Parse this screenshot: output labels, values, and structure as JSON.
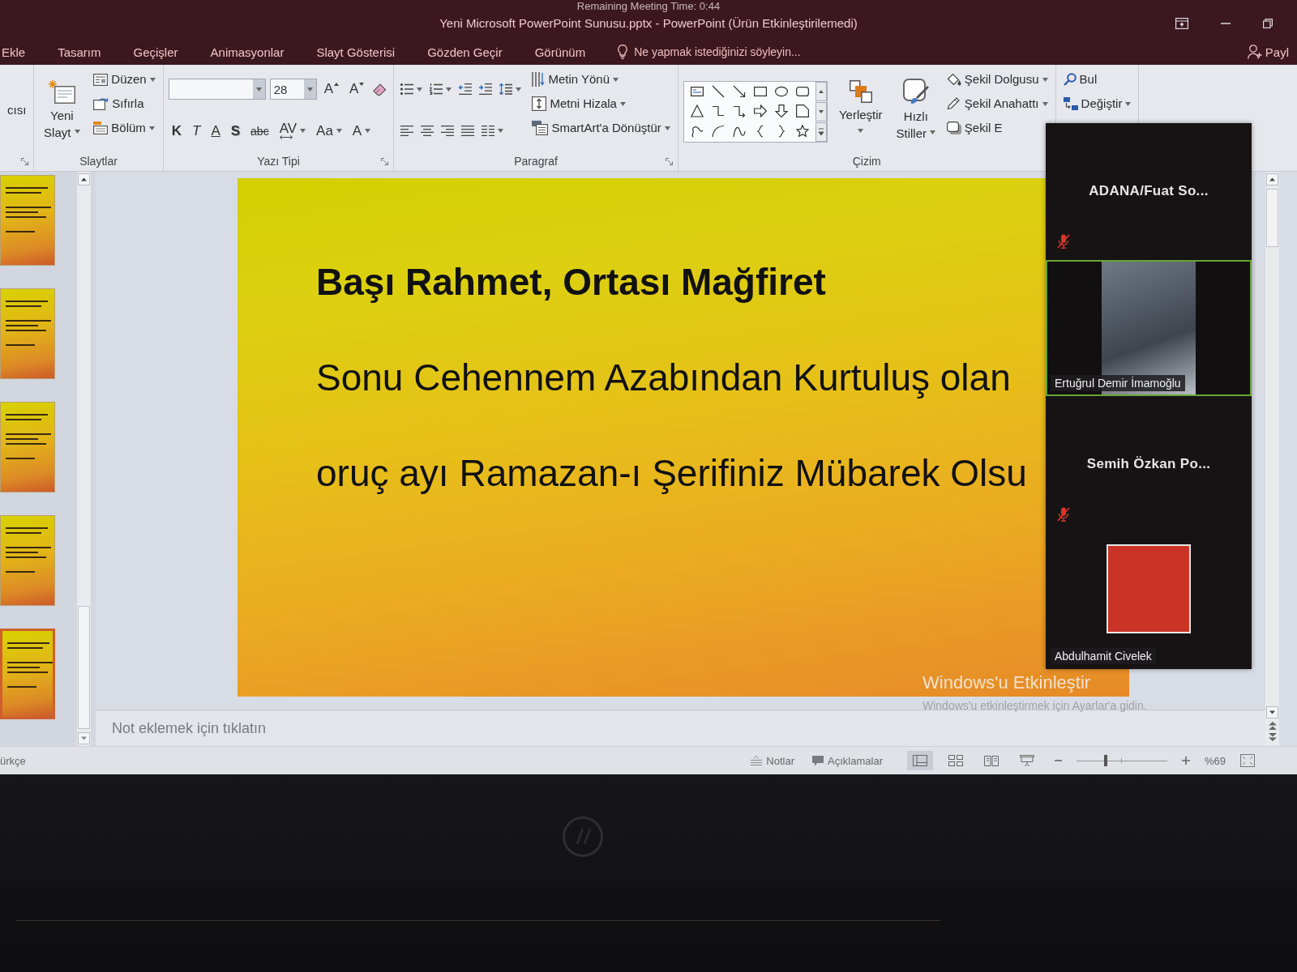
{
  "meeting_timer": "Remaining Meeting Time: 0:44",
  "window": {
    "title": "Yeni Microsoft PowerPoint Sunusu.pptx - PowerPoint (Ürün Etkinleştirilemedi)"
  },
  "tabs": [
    {
      "label": "Ekle",
      "selected": false
    },
    {
      "label": "Tasarım",
      "selected": false
    },
    {
      "label": "Geçişler",
      "selected": false
    },
    {
      "label": "Animasyonlar",
      "selected": false
    },
    {
      "label": "Slayt Gösterisi",
      "selected": false
    },
    {
      "label": "Gözden Geçir",
      "selected": false
    },
    {
      "label": "Görünüm",
      "selected": false
    }
  ],
  "tell_me": {
    "placeholder": "Ne yapmak istediğinizi söyleyin..."
  },
  "share": {
    "label": "Payl"
  },
  "ribbon": {
    "groups": [
      {
        "launcher": true,
        "blocks": [
          {
            "tiers": [
              [
                {
                  "kind": "text",
                  "label": "cısı",
                  "dropdown": false
                }
              ]
            ]
          }
        ]
      },
      {
        "label": "Slaytlar",
        "launcher": false,
        "blocks": [
          {
            "tiers": [
              [
                {
                  "kind": "newslide",
                  "label": "Yeni Slayt",
                  "dropdown": true
                }
              ]
            ]
          },
          {
            "tiers": [
              [
                {
                  "kind": "layout",
                  "label": "Düzen",
                  "dropdown": true
                }
              ],
              [
                {
                  "kind": "reset",
                  "label": "Sıfırla",
                  "dropdown": false
                }
              ],
              [
                {
                  "kind": "section",
                  "label": "Bölüm",
                  "dropdown": true
                }
              ]
            ]
          }
        ]
      },
      {
        "label": "Yazı Tipi",
        "launcher": true,
        "blocks": [
          {
            "tiers": [
              [
                {
                  "kind": "font",
                  "dropdown": true
                },
                {
                  "kind": "size",
                  "value": "28",
                  "dropdown": true
                },
                {
                  "kind": "grow",
                  "label": "A",
                  "dropdown": false
                },
                {
                  "kind": "shrink",
                  "label": "A",
                  "dropdown": false
                },
                {
                  "kind": "clear",
                  "dropdown": false
                }
              ],
              [
                {
                  "kind": "bold",
                  "label": "K",
                  "dropdown": false
                },
                {
                  "kind": "italic",
                  "label": "T",
                  "dropdown": false
                },
                {
                  "kind": "underline",
                  "label": "A",
                  "dropdown": false
                },
                {
                  "kind": "shadow",
                  "label": "S",
                  "dropdown": false
                },
                {
                  "kind": "strike",
                  "label": "abc",
                  "dropdown": false
                },
                {
                  "kind": "charspacing",
                  "label": "AV",
                  "dropdown": true
                },
                {
                  "kind": "case",
                  "label": "Aa",
                  "dropdown": true
                },
                {
                  "kind": "fontcolor",
                  "label": "A",
                  "dropdown": true
                }
              ]
            ]
          }
        ]
      },
      {
        "label": "Paragraf",
        "launcher": true,
        "blocks": [
          {
            "tiers": [
              [
                {
                  "kind": "bullets",
                  "dropdown": true
                },
                {
                  "kind": "numbering",
                  "dropdown": true
                },
                {
                  "kind": "outdent",
                  "dropdown": false
                },
                {
                  "kind": "indent",
                  "dropdown": false
                },
                {
                  "kind": "spacing",
                  "dropdown": true
                }
              ],
              [
                {
                  "kind": "left",
                  "dropdown": false
                },
                {
                  "kind": "center",
                  "dropdown": false
                },
                {
                  "kind": "right",
                  "dropdown": false
                },
                {
                  "kind": "justify",
                  "dropdown": false
                },
                {
                  "kind": "columns",
                  "dropdown": true
                }
              ]
            ]
          },
          {
            "tiers": [
              [
                {
                  "kind": "textdir",
                  "label": "Metin Yönü",
                  "dropdown": true
                }
              ],
              [
                {
                  "kind": "textalign",
                  "label": "Metni Hizala",
                  "dropdown": true
                }
              ],
              [
                {
                  "kind": "smartart",
                  "label": "SmartArt'a Dönüştür",
                  "dropdown": true
                }
              ]
            ]
          }
        ]
      },
      {
        "label": "Çizim",
        "launcher": false,
        "blocks": [
          {
            "tiers": [
              [
                {
                  "kind": "shapes",
                  "dropdown": false
                }
              ]
            ]
          },
          {
            "tiers": [
              [
                {
                  "kind": "arrange",
                  "label": "Yerleştir",
                  "dropdown": true
                }
              ]
            ]
          },
          {
            "tiers": [
              [
                {
                  "kind": "quickstyles",
                  "label": "Hızlı Stiller",
                  "dropdown": true
                }
              ]
            ]
          },
          {
            "tiers": [
              [
                {
                  "kind": "fill",
                  "label": "Şekil Dolgusu",
                  "dropdown": true
                }
              ],
              [
                {
                  "kind": "outline",
                  "label": "Şekil Anahattı",
                  "dropdown": true
                }
              ],
              [
                {
                  "kind": "effects",
                  "label": "Şekil E",
                  "dropdown": false
                }
              ]
            ]
          }
        ]
      },
      {
        "blocks": [
          {
            "tiers": [
              [
                {
                  "kind": "find",
                  "label": "Bul",
                  "dropdown": false
                }
              ],
              [
                {
                  "kind": "replace",
                  "label": "Değiştir",
                  "dropdown": true
                }
              ]
            ]
          }
        ]
      }
    ]
  },
  "thumbnails": [
    {
      "selected": false
    },
    {
      "selected": false
    },
    {
      "selected": false
    },
    {
      "selected": false
    },
    {
      "selected": true
    }
  ],
  "slide": {
    "title": "Başı Rahmet, Ortası Mağfiret",
    "lines": [
      "Sonu Cehennem Azabından Kurtuluş olan",
      "oruç ayı Ramazan-ı Şerifiniz Mübarek Olsu"
    ]
  },
  "notes": {
    "placeholder": "Not eklemek için tıklatın"
  },
  "meeting": {
    "participants": [
      {
        "name": "ADANA/Fuat So...",
        "kind": "name",
        "muted": true,
        "speaking": false
      },
      {
        "name": "Ertuğrul Demir İmamoğlu",
        "kind": "video",
        "muted": false,
        "speaking": true
      },
      {
        "name": "Semih Özkan Po...",
        "kind": "name",
        "muted": true,
        "speaking": false
      },
      {
        "name": "Abdulhamit Civelek",
        "kind": "photo",
        "muted": false,
        "speaking": false
      }
    ]
  },
  "activation_notice": {
    "title": "Windows'u Etkinleştir",
    "hint": "Windows'u etkinleştirmek için Ayarlar'a gidin."
  },
  "status_bar": {
    "language": "ürkçe",
    "notes": "Notlar",
    "comments": "Açıklamalar",
    "views": [
      {
        "kind": "normal",
        "selected": true
      },
      {
        "kind": "sorter",
        "selected": false
      },
      {
        "kind": "reading",
        "selected": false
      },
      {
        "kind": "slideshow",
        "selected": false
      }
    ],
    "zoom": {
      "level": 0.32,
      "reading": "%69"
    }
  }
}
